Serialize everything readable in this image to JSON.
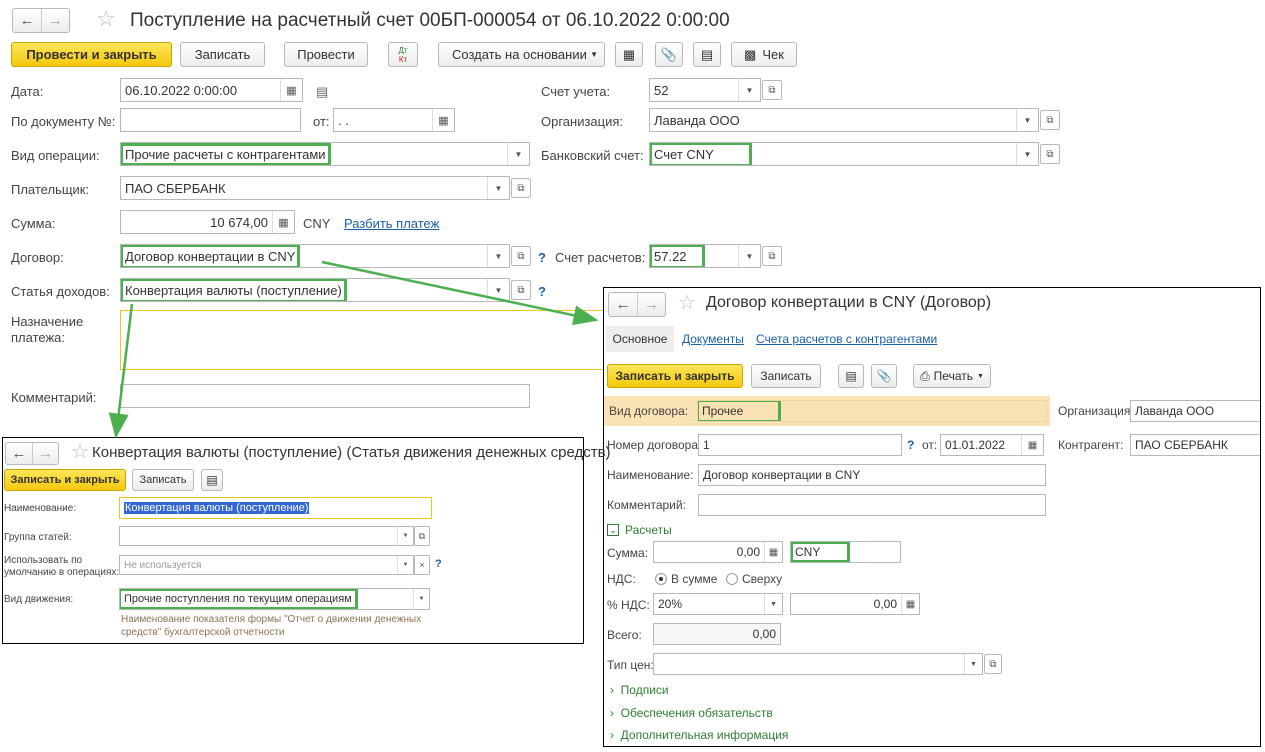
{
  "main": {
    "title": "Поступление на расчетный счет 00БП-000054 от 06.10.2022 0:00:00",
    "toolbar": {
      "post_close": "Провести и закрыть",
      "save": "Записать",
      "post": "Провести",
      "dtkt_top": "Дт",
      "dtkt_bot": "Кт",
      "create_based": "Создать на основании",
      "check": "Чек"
    },
    "labels": {
      "date": "Дата:",
      "doc_no": "По документу №:",
      "from": "от:",
      "op_type": "Вид операции:",
      "payer": "Плательщик:",
      "sum": "Сумма:",
      "contract": "Договор:",
      "income_item": "Статья доходов:",
      "purpose_1": "Назначение",
      "purpose_2": "платежа:",
      "comment": "Комментарий:",
      "account": "Счет учета:",
      "org": "Организация:",
      "bank_account": "Банковский счет:",
      "settle_account": "Счет расчетов:"
    },
    "values": {
      "date": "06.10.2022  0:00:00",
      "doc_no": "",
      "from": " .  .",
      "op_type": "Прочие расчеты с контрагентами",
      "payer": "ПАО СБЕРБАНК",
      "sum": "10 674,00",
      "currency": "CNY",
      "split": "Разбить платеж",
      "contract": "Договор конвертации в CNY",
      "income_item": "Конвертация валюты (поступление)",
      "account": "52",
      "org": "Лаванда ООО",
      "bank_account": "Счет CNY",
      "settle_account": "57.22",
      "help": "?"
    }
  },
  "contract_win": {
    "title": "Договор конвертации в CNY (Договор)",
    "tabs": [
      "Основное",
      "Документы",
      "Счета расчетов с контрагентами"
    ],
    "toolbar": {
      "save_close": "Записать и закрыть",
      "save": "Записать",
      "print": "Печать"
    },
    "labels": {
      "type": "Вид договора:",
      "org": "Организация:",
      "number": "Номер договора:",
      "from": "от:",
      "counterparty": "Контрагент:",
      "name": "Наименование:",
      "comment": "Комментарий:",
      "settlements": "Расчеты",
      "sum": "Сумма:",
      "vat": "НДС:",
      "vat_in": "В сумме",
      "vat_top": "Сверху",
      "vat_pct": "% НДС:",
      "total": "Всего:",
      "price_type": "Тип цен:",
      "signatures": "Подписи",
      "obligations": "Обеспечения обязательств",
      "extra": "Дополнительная информация"
    },
    "values": {
      "type": "Прочее",
      "org": "Лаванда ООО",
      "number": "1",
      "date": "01.01.2022",
      "counterparty": "ПАО СБЕРБАНК",
      "name": "Договор конвертации в CNY",
      "comment": "",
      "sum": "0,00",
      "currency": "CNY",
      "vat_pct": "20%",
      "vat_sum": "0,00",
      "total": "0,00",
      "price_type": "",
      "help": "?"
    }
  },
  "item_win": {
    "title": "Конвертация валюты (поступление) (Статья движения денежных средств)",
    "toolbar": {
      "save_close": "Записать и закрыть",
      "save": "Записать"
    },
    "labels": {
      "name": "Наименование:",
      "group": "Группа статей:",
      "default_1": "Использовать по",
      "default_2": "умолчанию в операциях:",
      "movement": "Вид движения:"
    },
    "values": {
      "name": "Конвертация валюты (поступление)",
      "group": "",
      "default": "Не используется",
      "movement": "Прочие поступления по текущим операциям",
      "help": "?"
    },
    "note_1": "Наименование показателя формы \"Отчет о движении денежных",
    "note_2": "средств\" бухгалтерской отчетности"
  },
  "colors": {
    "highlight": "#4caf50",
    "accent": "#f4c80c",
    "link": "#1a5fa8"
  }
}
